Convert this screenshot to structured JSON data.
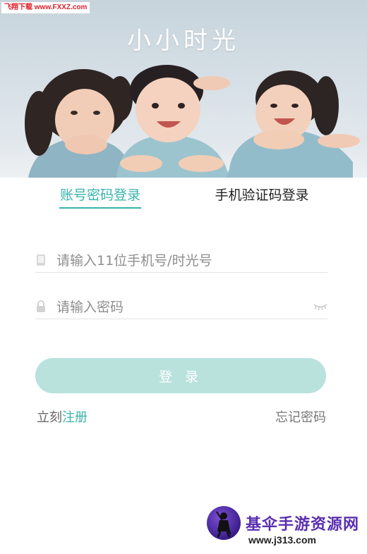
{
  "watermark_top": "飞翔下载 www.FXXZ.com",
  "header": {
    "app_title": "小小时光"
  },
  "tabs": [
    {
      "label": "账号密码登录",
      "active": true
    },
    {
      "label": "手机验证码登录",
      "active": false
    }
  ],
  "form": {
    "phone": {
      "placeholder": "请输入11位手机号/时光号",
      "value": ""
    },
    "password": {
      "placeholder": "请输入密码",
      "value": ""
    },
    "login_label": "登 录"
  },
  "links": {
    "register_prefix": "立刻",
    "register_link": "注册",
    "forgot": "忘记密码"
  },
  "watermark_bottom": {
    "site_name": "基伞手游资源网",
    "url": "www.j313.com"
  },
  "colors": {
    "accent": "#37b2aa",
    "button_bg": "#b9e2dd",
    "placeholder": "#8e8e8e",
    "text_dark": "#222222"
  },
  "icons": {
    "phone_field": "phone-icon",
    "password_field": "lock-icon",
    "password_toggle": "eye-closed-icon"
  }
}
